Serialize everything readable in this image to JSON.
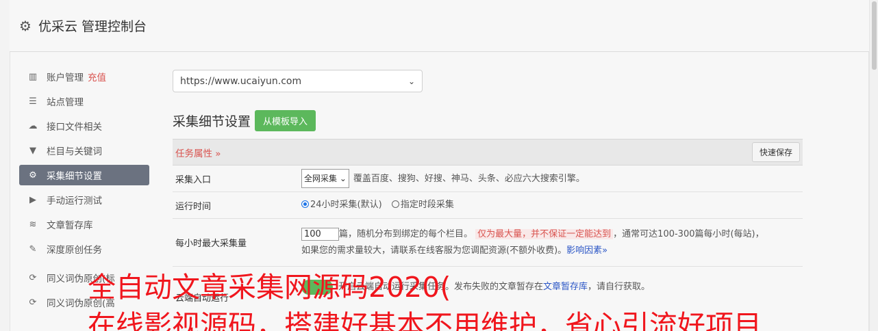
{
  "header": {
    "title": "优采云 管理控制台",
    "icon": "gear-icon"
  },
  "sidebar": {
    "items": [
      {
        "label": "账户管理",
        "badge": "充值",
        "icon": "bar-chart-icon"
      },
      {
        "label": "站点管理",
        "icon": "server-icon"
      },
      {
        "label": "接口文件相关",
        "icon": "cloud-upload-icon"
      },
      {
        "label": "栏目与关键词",
        "icon": "filter-icon"
      },
      {
        "label": "采集细节设置",
        "icon": "gears-icon",
        "active": true
      },
      {
        "label": "手动运行测试",
        "icon": "play-circle-icon"
      },
      {
        "label": "文章暂存库",
        "icon": "database-icon"
      },
      {
        "label": "深度原创任务",
        "icon": "edit-icon"
      },
      {
        "label": "同义词伪原创(标",
        "icon": "refresh-icon"
      },
      {
        "label": "同义词伪原创(高",
        "icon": "refresh-icon"
      }
    ]
  },
  "main": {
    "site_select": "https://www.ucaiyun.com",
    "section_title": "采集细节设置",
    "import_button": "从模板导入",
    "task_props": "任务属性 »",
    "quick_save": "快速保存",
    "rows": {
      "entry": {
        "label": "采集入口",
        "select": "全网采集",
        "desc": "覆盖百度、搜狗、好搜、神马、头条、必应六大搜索引擎。"
      },
      "runtime": {
        "label": "运行时间",
        "opt1": "24小时采集(默认)",
        "opt2": "指定时段采集"
      },
      "max": {
        "label": "每小时最大采集量",
        "value": "100",
        "text1": "篇，随机分布到绑定的每个栏目。",
        "warn": "仅为最大量，并不保证一定能达到",
        "text2": "，通常可达100-300篇每小时(每站)，",
        "text3": "如果您的需求量较大，请联系在线客服为您调配资源(不额外收费)。",
        "link": "影响因素»"
      },
      "cloud": {
        "label": "云端自动运行",
        "text1": "开启云端自动运行采集任务。发布失败的文章暂存在",
        "link": "文章暂存库",
        "text2": "，请自行获取。"
      }
    }
  },
  "overlay": {
    "line1": "全自动文章采集网源码2020(",
    "line2": "在线影视源码，搭建好基本不用维护，省心引流好项目"
  }
}
